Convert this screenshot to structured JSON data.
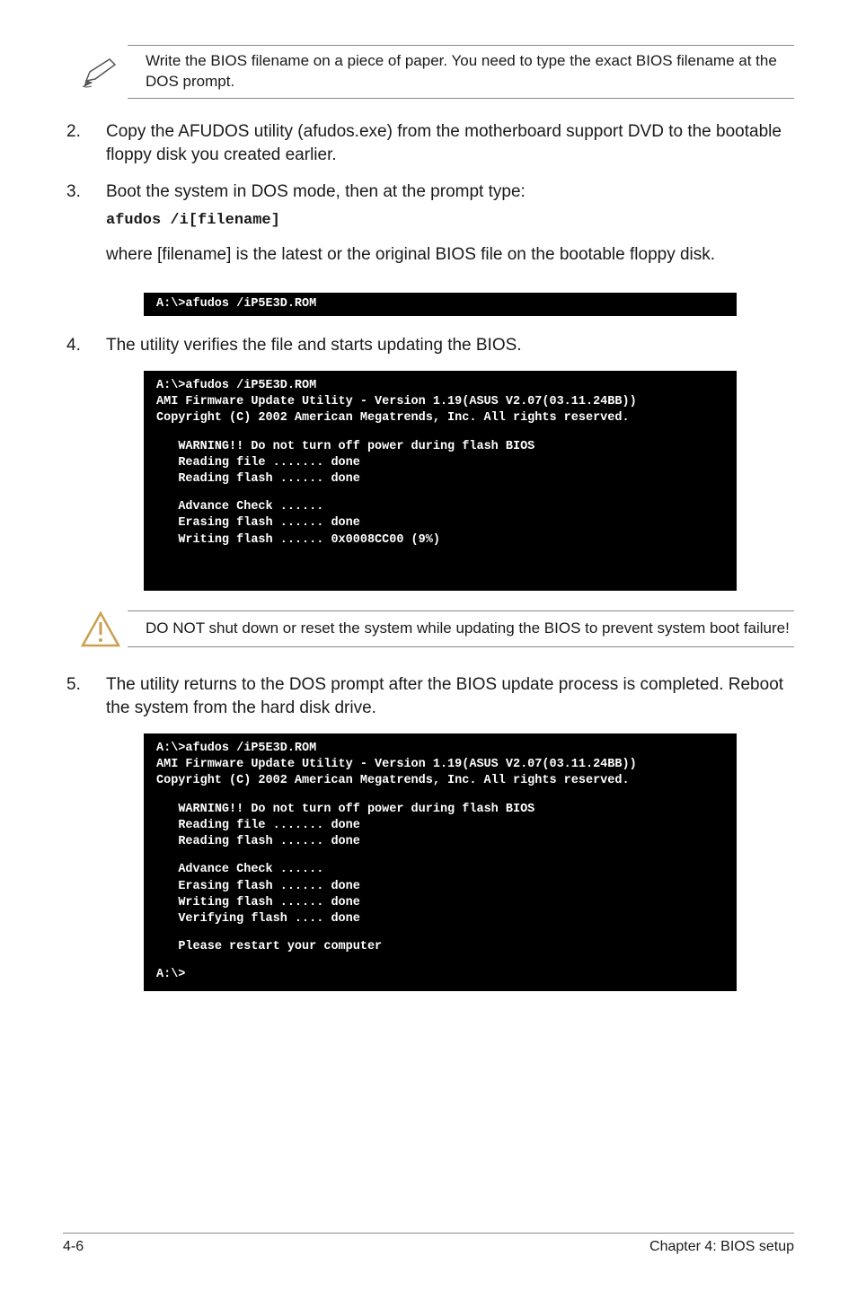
{
  "note": {
    "text": "Write the BIOS filename on a piece of paper. You need to type the exact BIOS filename at the DOS prompt."
  },
  "steps": {
    "s2": {
      "num": "2.",
      "text": "Copy the AFUDOS utility (afudos.exe) from the motherboard support DVD to the bootable floppy disk you created earlier."
    },
    "s3": {
      "num": "3.",
      "text": "Boot the system in DOS mode, then at the prompt type:",
      "cmd": "afudos /i[filename]",
      "extra": "where [filename] is the latest or the original BIOS file on the bootable floppy disk."
    },
    "s4": {
      "num": "4.",
      "text": "The utility verifies the file and starts updating the BIOS."
    },
    "s5": {
      "num": "5.",
      "text": "The utility returns to the DOS prompt after the BIOS update process is completed. Reboot the system from the hard disk drive."
    }
  },
  "terminals": {
    "t1": "A:\\>afudos /iP5E3D.ROM",
    "t2_line1": "A:\\>afudos /iP5E3D.ROM",
    "t2_line2": "AMI Firmware Update Utility - Version 1.19(ASUS V2.07(03.11.24BB))",
    "t2_line3": "Copyright (C) 2002 American Megatrends, Inc. All rights reserved.",
    "t2_line4": "   WARNING!! Do not turn off power during flash BIOS",
    "t2_line5": "   Reading file ....... done",
    "t2_line6": "   Reading flash ...... done",
    "t2_line7": "   Advance Check ......",
    "t2_line8": "   Erasing flash ...... done",
    "t2_line9": "   Writing flash ...... 0x0008CC00 (9%)",
    "t3_line1": "A:\\>afudos /iP5E3D.ROM",
    "t3_line2": "AMI Firmware Update Utility - Version 1.19(ASUS V2.07(03.11.24BB))",
    "t3_line3": "Copyright (C) 2002 American Megatrends, Inc. All rights reserved.",
    "t3_line4": "   WARNING!! Do not turn off power during flash BIOS",
    "t3_line5": "   Reading file ....... done",
    "t3_line6": "   Reading flash ...... done",
    "t3_line7": "   Advance Check ......",
    "t3_line8": "   Erasing flash ...... done",
    "t3_line9": "   Writing flash ...... done",
    "t3_line10": "   Verifying flash .... done",
    "t3_line11": "   Please restart your computer",
    "t3_line12": "A:\\>"
  },
  "warning": {
    "text": "DO NOT shut down or reset the system while updating the BIOS to prevent system boot failure!"
  },
  "footer": {
    "left": "4-6",
    "right": "Chapter 4: BIOS setup"
  }
}
